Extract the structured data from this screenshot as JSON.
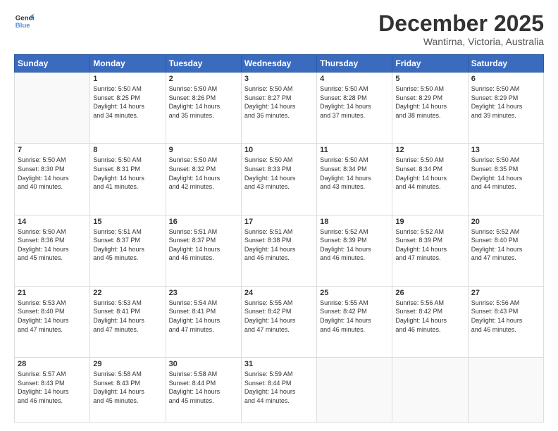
{
  "header": {
    "logo_line1": "General",
    "logo_line2": "Blue",
    "month": "December 2025",
    "location": "Wantirna, Victoria, Australia"
  },
  "weekdays": [
    "Sunday",
    "Monday",
    "Tuesday",
    "Wednesday",
    "Thursday",
    "Friday",
    "Saturday"
  ],
  "weeks": [
    [
      {
        "day": "",
        "info": ""
      },
      {
        "day": "1",
        "info": "Sunrise: 5:50 AM\nSunset: 8:25 PM\nDaylight: 14 hours\nand 34 minutes."
      },
      {
        "day": "2",
        "info": "Sunrise: 5:50 AM\nSunset: 8:26 PM\nDaylight: 14 hours\nand 35 minutes."
      },
      {
        "day": "3",
        "info": "Sunrise: 5:50 AM\nSunset: 8:27 PM\nDaylight: 14 hours\nand 36 minutes."
      },
      {
        "day": "4",
        "info": "Sunrise: 5:50 AM\nSunset: 8:28 PM\nDaylight: 14 hours\nand 37 minutes."
      },
      {
        "day": "5",
        "info": "Sunrise: 5:50 AM\nSunset: 8:29 PM\nDaylight: 14 hours\nand 38 minutes."
      },
      {
        "day": "6",
        "info": "Sunrise: 5:50 AM\nSunset: 8:29 PM\nDaylight: 14 hours\nand 39 minutes."
      }
    ],
    [
      {
        "day": "7",
        "info": "Sunrise: 5:50 AM\nSunset: 8:30 PM\nDaylight: 14 hours\nand 40 minutes."
      },
      {
        "day": "8",
        "info": "Sunrise: 5:50 AM\nSunset: 8:31 PM\nDaylight: 14 hours\nand 41 minutes."
      },
      {
        "day": "9",
        "info": "Sunrise: 5:50 AM\nSunset: 8:32 PM\nDaylight: 14 hours\nand 42 minutes."
      },
      {
        "day": "10",
        "info": "Sunrise: 5:50 AM\nSunset: 8:33 PM\nDaylight: 14 hours\nand 43 minutes."
      },
      {
        "day": "11",
        "info": "Sunrise: 5:50 AM\nSunset: 8:34 PM\nDaylight: 14 hours\nand 43 minutes."
      },
      {
        "day": "12",
        "info": "Sunrise: 5:50 AM\nSunset: 8:34 PM\nDaylight: 14 hours\nand 44 minutes."
      },
      {
        "day": "13",
        "info": "Sunrise: 5:50 AM\nSunset: 8:35 PM\nDaylight: 14 hours\nand 44 minutes."
      }
    ],
    [
      {
        "day": "14",
        "info": "Sunrise: 5:50 AM\nSunset: 8:36 PM\nDaylight: 14 hours\nand 45 minutes."
      },
      {
        "day": "15",
        "info": "Sunrise: 5:51 AM\nSunset: 8:37 PM\nDaylight: 14 hours\nand 45 minutes."
      },
      {
        "day": "16",
        "info": "Sunrise: 5:51 AM\nSunset: 8:37 PM\nDaylight: 14 hours\nand 46 minutes."
      },
      {
        "day": "17",
        "info": "Sunrise: 5:51 AM\nSunset: 8:38 PM\nDaylight: 14 hours\nand 46 minutes."
      },
      {
        "day": "18",
        "info": "Sunrise: 5:52 AM\nSunset: 8:39 PM\nDaylight: 14 hours\nand 46 minutes."
      },
      {
        "day": "19",
        "info": "Sunrise: 5:52 AM\nSunset: 8:39 PM\nDaylight: 14 hours\nand 47 minutes."
      },
      {
        "day": "20",
        "info": "Sunrise: 5:52 AM\nSunset: 8:40 PM\nDaylight: 14 hours\nand 47 minutes."
      }
    ],
    [
      {
        "day": "21",
        "info": "Sunrise: 5:53 AM\nSunset: 8:40 PM\nDaylight: 14 hours\nand 47 minutes."
      },
      {
        "day": "22",
        "info": "Sunrise: 5:53 AM\nSunset: 8:41 PM\nDaylight: 14 hours\nand 47 minutes."
      },
      {
        "day": "23",
        "info": "Sunrise: 5:54 AM\nSunset: 8:41 PM\nDaylight: 14 hours\nand 47 minutes."
      },
      {
        "day": "24",
        "info": "Sunrise: 5:55 AM\nSunset: 8:42 PM\nDaylight: 14 hours\nand 47 minutes."
      },
      {
        "day": "25",
        "info": "Sunrise: 5:55 AM\nSunset: 8:42 PM\nDaylight: 14 hours\nand 46 minutes."
      },
      {
        "day": "26",
        "info": "Sunrise: 5:56 AM\nSunset: 8:42 PM\nDaylight: 14 hours\nand 46 minutes."
      },
      {
        "day": "27",
        "info": "Sunrise: 5:56 AM\nSunset: 8:43 PM\nDaylight: 14 hours\nand 46 minutes."
      }
    ],
    [
      {
        "day": "28",
        "info": "Sunrise: 5:57 AM\nSunset: 8:43 PM\nDaylight: 14 hours\nand 46 minutes."
      },
      {
        "day": "29",
        "info": "Sunrise: 5:58 AM\nSunset: 8:43 PM\nDaylight: 14 hours\nand 45 minutes."
      },
      {
        "day": "30",
        "info": "Sunrise: 5:58 AM\nSunset: 8:44 PM\nDaylight: 14 hours\nand 45 minutes."
      },
      {
        "day": "31",
        "info": "Sunrise: 5:59 AM\nSunset: 8:44 PM\nDaylight: 14 hours\nand 44 minutes."
      },
      {
        "day": "",
        "info": ""
      },
      {
        "day": "",
        "info": ""
      },
      {
        "day": "",
        "info": ""
      }
    ]
  ]
}
